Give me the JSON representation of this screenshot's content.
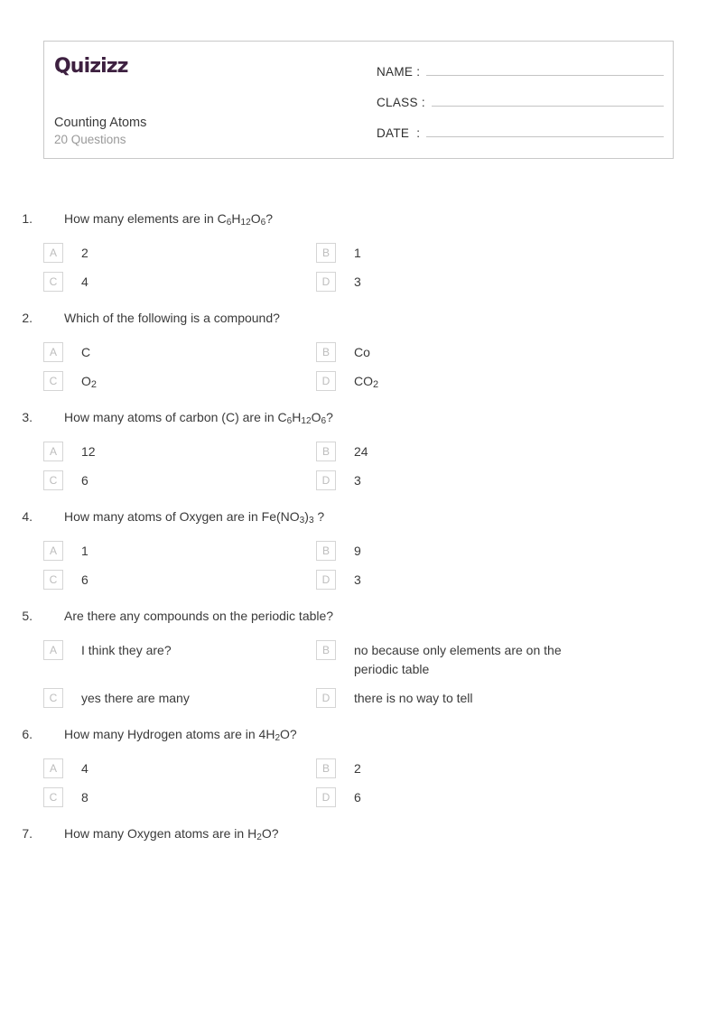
{
  "header": {
    "logo_text": "Quizizz",
    "quiz_title": "Counting Atoms",
    "question_count_label": "20 Questions",
    "fields": [
      {
        "label": "NAME :",
        "value": ""
      },
      {
        "label": "CLASS :",
        "value": ""
      },
      {
        "label": "DATE  :",
        "value": ""
      }
    ]
  },
  "option_letters": [
    "A",
    "B",
    "C",
    "D"
  ],
  "questions": [
    {
      "number": "1.",
      "text_html": "How many elements are in C<sub>6</sub>H<sub>12</sub>O<sub>6</sub>?",
      "text_plain": "How many elements are in C6H12O6?",
      "options": [
        {
          "letter": "A",
          "text_html": "2",
          "text_plain": "2"
        },
        {
          "letter": "B",
          "text_html": "1",
          "text_plain": "1"
        },
        {
          "letter": "C",
          "text_html": "4",
          "text_plain": "4"
        },
        {
          "letter": "D",
          "text_html": "3",
          "text_plain": "3"
        }
      ]
    },
    {
      "number": "2.",
      "text_html": "Which of the following is a compound?",
      "text_plain": "Which of the following is a compound?",
      "options": [
        {
          "letter": "A",
          "text_html": "C",
          "text_plain": "C"
        },
        {
          "letter": "B",
          "text_html": "Co",
          "text_plain": "Co"
        },
        {
          "letter": "C",
          "text_html": "O<sub>2</sub>",
          "text_plain": "O2"
        },
        {
          "letter": "D",
          "text_html": "CO<sub>2</sub>",
          "text_plain": "CO2"
        }
      ]
    },
    {
      "number": "3.",
      "text_html": "How many atoms of carbon (C) are in C<sub>6</sub>H<sub>12</sub>O<sub>6</sub>?",
      "text_plain": "How many atoms of carbon (C) are in C6H12O6?",
      "options": [
        {
          "letter": "A",
          "text_html": "12",
          "text_plain": "12"
        },
        {
          "letter": "B",
          "text_html": "24",
          "text_plain": "24"
        },
        {
          "letter": "C",
          "text_html": "6",
          "text_plain": "6"
        },
        {
          "letter": "D",
          "text_html": "3",
          "text_plain": "3"
        }
      ]
    },
    {
      "number": "4.",
      "text_html": "How many atoms of Oxygen are in Fe(NO<sub>3</sub>)<sub>3</sub> ?",
      "text_plain": "How many atoms of Oxygen are in Fe(NO3)3 ?",
      "options": [
        {
          "letter": "A",
          "text_html": "1",
          "text_plain": "1"
        },
        {
          "letter": "B",
          "text_html": "9",
          "text_plain": "9"
        },
        {
          "letter": "C",
          "text_html": "6",
          "text_plain": "6"
        },
        {
          "letter": "D",
          "text_html": "3",
          "text_plain": "3"
        }
      ]
    },
    {
      "number": "5.",
      "text_html": "Are there any compounds on the periodic table?",
      "text_plain": "Are there any compounds on the periodic table?",
      "options": [
        {
          "letter": "A",
          "text_html": "I think they are?",
          "text_plain": "I think they are?"
        },
        {
          "letter": "B",
          "text_html": "no because only elements are on the periodic table",
          "text_plain": "no because only elements are on the periodic table"
        },
        {
          "letter": "C",
          "text_html": "yes there are many",
          "text_plain": "yes there are many"
        },
        {
          "letter": "D",
          "text_html": "there is no way to tell",
          "text_plain": "there is no way to tell"
        }
      ]
    },
    {
      "number": "6.",
      "text_html": "How many Hydrogen atoms are in 4H<sub>2</sub>O?",
      "text_plain": "How many Hydrogen atoms are in 4H2O?",
      "options": [
        {
          "letter": "A",
          "text_html": "4",
          "text_plain": "4"
        },
        {
          "letter": "B",
          "text_html": "2",
          "text_plain": "2"
        },
        {
          "letter": "C",
          "text_html": "8",
          "text_plain": "8"
        },
        {
          "letter": "D",
          "text_html": "6",
          "text_plain": "6"
        }
      ]
    },
    {
      "number": "7.",
      "text_html": "How many Oxygen atoms are in H<sub>2</sub>O?",
      "text_plain": "How many Oxygen atoms are in H2O?",
      "options": []
    }
  ]
}
